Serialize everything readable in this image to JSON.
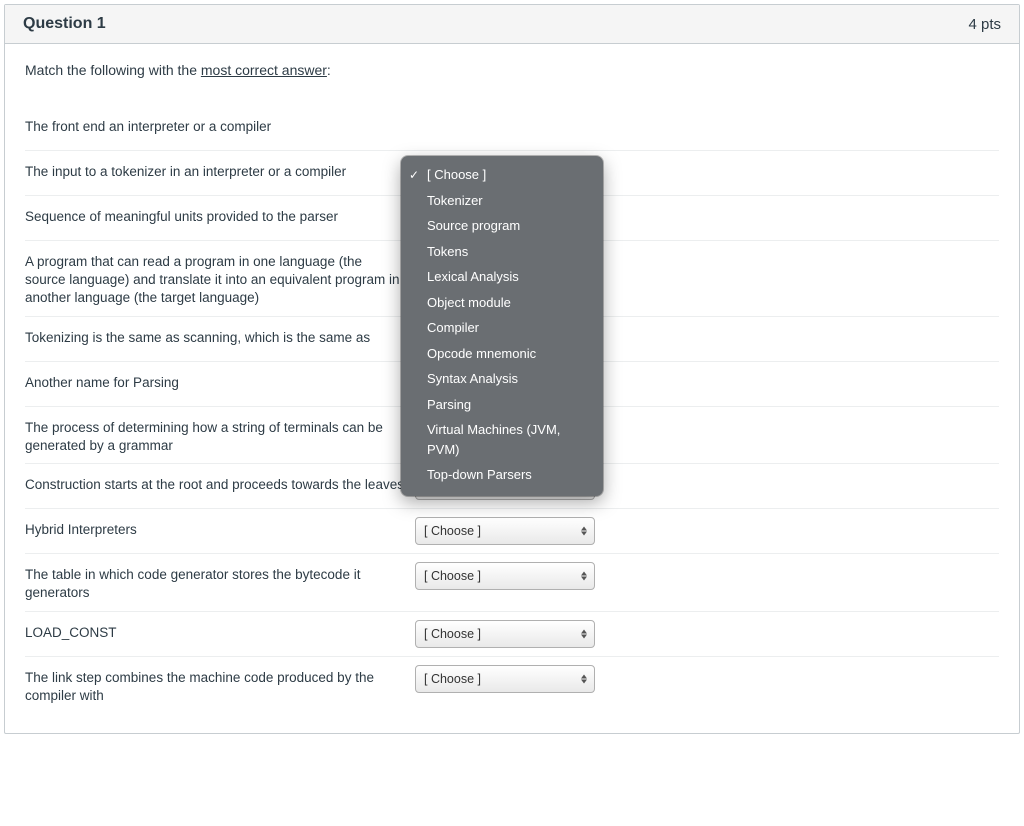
{
  "header": {
    "title": "Question 1",
    "points": "4 pts"
  },
  "instruction": {
    "prefix": "Match the following with the ",
    "underlined": "most correct answer",
    "suffix": ":"
  },
  "choose_placeholder": "[ Choose ]",
  "prompts": [
    "The front end an interpreter or a compiler",
    "The input to a tokenizer in an interpreter or a compiler",
    "Sequence of meaningful units provided to the parser",
    "A program that can read a program in one language (the source language) and translate it into an equivalent program in another language (the target language)",
    "Tokenizing is the same as scanning, which is the same as",
    "Another name for Parsing",
    "The process of determining how a string of terminals can be generated by a grammar",
    "Construction starts at the root and proceeds towards the leaves",
    "Hybrid Interpreters",
    "The table in which code generator stores the bytecode it generators",
    "LOAD_CONST",
    "The link step combines the machine code produced by the compiler with"
  ],
  "options": [
    "[ Choose ]",
    "Tokenizer",
    "Source program",
    "Tokens",
    "Lexical Analysis",
    "Object module",
    "Compiler",
    "Opcode mnemonic",
    "Syntax Analysis",
    "Parsing",
    "Virtual Machines (JVM, PVM)",
    "Top-down Parsers"
  ],
  "selected_option_index": 0,
  "rows_without_visible_select": [
    0,
    1,
    2,
    3,
    4
  ]
}
